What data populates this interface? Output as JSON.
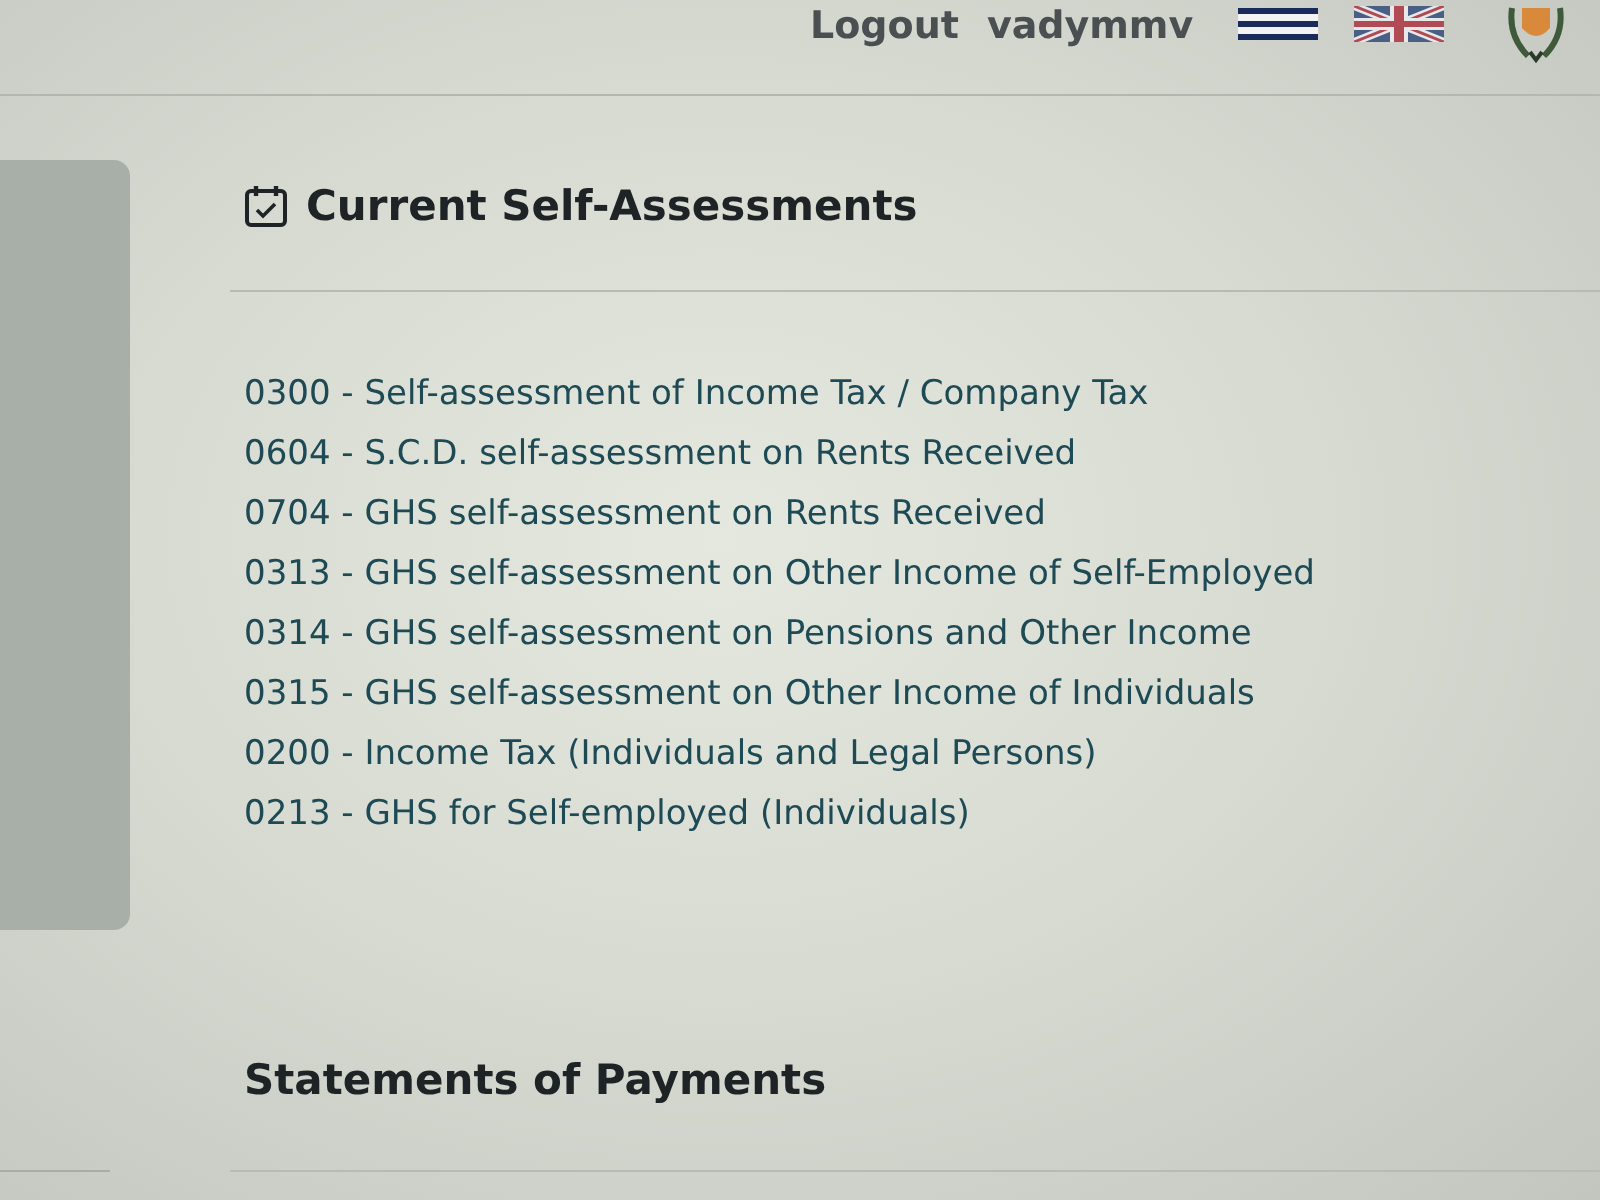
{
  "header": {
    "logout_link": "Logout",
    "user_name": "vadymmv"
  },
  "self_assessments": {
    "title": "Current Self-Assessments",
    "items": [
      "0300 - Self-assessment of Income Tax / Company Tax",
      "0604 - S.C.D. self-assessment on Rents Received",
      "0704 - GHS self-assessment on Rents Received",
      "0313 - GHS self-assessment on Other Income of Self-Employed",
      "0314 - GHS self-assessment on Pensions and Other Income",
      "0315 - GHS self-assessment on Other Income of Individuals",
      "0200 - Income Tax (Individuals and Legal Persons)",
      "0213 - GHS for Self-employed (Individuals)"
    ]
  },
  "statements": {
    "title": "Statements of Payments"
  }
}
